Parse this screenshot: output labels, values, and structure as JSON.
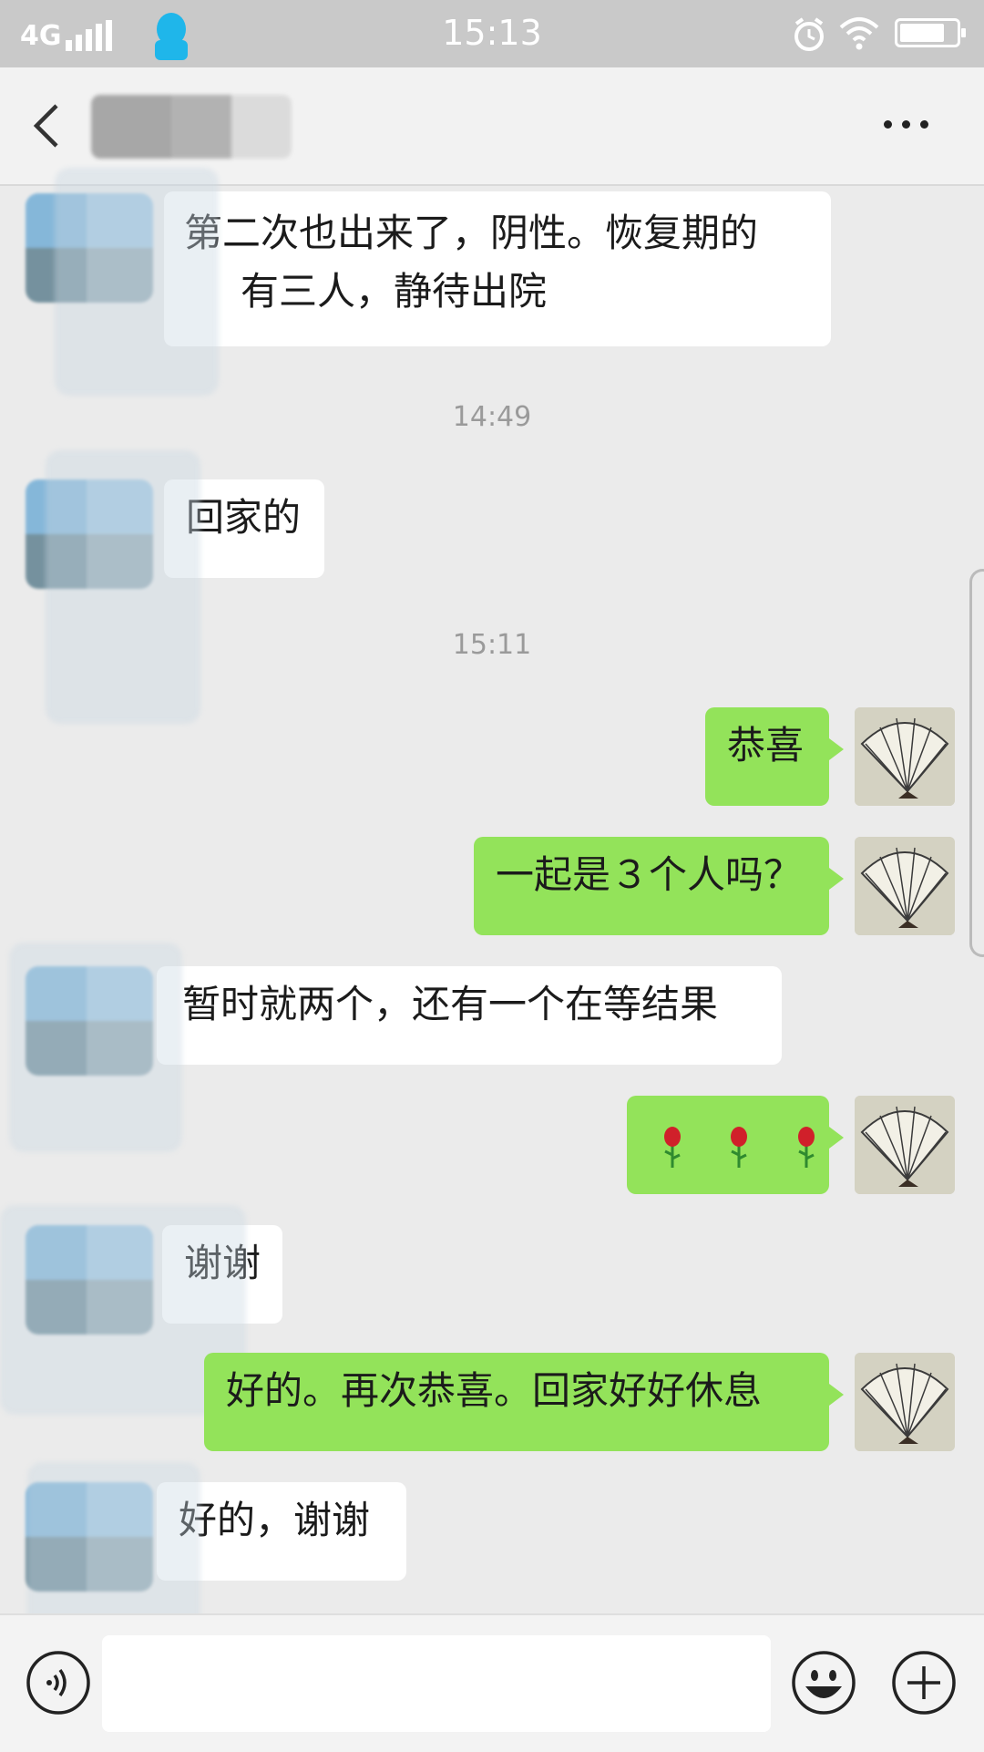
{
  "status_bar": {
    "network": "4G",
    "time": "15:13"
  },
  "header": {
    "back_icon": "chevron-left-icon",
    "more_icon": "more-dots-icon"
  },
  "messages": [
    {
      "side": "in",
      "lines": [
        "第二次也出来了，阴性。恢复期的",
        "有三人，静待出院"
      ]
    },
    {
      "type": "timestamp",
      "text": "14:49"
    },
    {
      "side": "in",
      "text": "回家的"
    },
    {
      "type": "timestamp",
      "text": "15:11"
    },
    {
      "side": "out",
      "text": "恭喜"
    },
    {
      "side": "out",
      "text": "一起是３个人吗？"
    },
    {
      "side": "in",
      "text": "暂时就两个，还有一个在等结果"
    },
    {
      "side": "out",
      "text": "🌹🌹🌹",
      "icon": "rose-icon"
    },
    {
      "side": "in",
      "text": "谢谢"
    },
    {
      "side": "out",
      "text": "好的。再次恭喜。回家好好休息"
    },
    {
      "side": "in",
      "text": "好的，谢谢"
    }
  ],
  "input_bar": {
    "voice_icon": "voice-icon",
    "input_value": "",
    "emoji_icon": "emoji-icon",
    "plus_icon": "plus-icon"
  },
  "colors": {
    "outgoing_bubble": "#93e35a",
    "incoming_bubble": "#ffffff",
    "chat_background": "#ebebeb"
  }
}
